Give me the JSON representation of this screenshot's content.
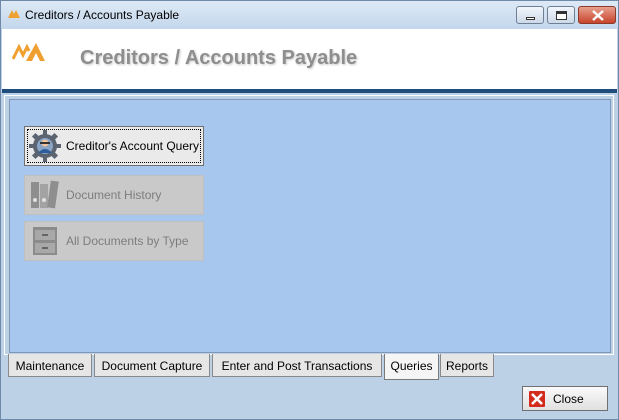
{
  "window": {
    "title": "Creditors / Accounts Payable"
  },
  "header": {
    "title": "Creditors / Accounts Payable"
  },
  "tiles": [
    {
      "label": "Creditor's Account Query",
      "icon": "gear-person-icon",
      "enabled": true
    },
    {
      "label": "Document History",
      "icon": "binders-icon",
      "enabled": false
    },
    {
      "label": "All Documents by Type",
      "icon": "cabinet-drawer-icon",
      "enabled": false
    }
  ],
  "tabs": [
    {
      "label": "Maintenance",
      "selected": false
    },
    {
      "label": "Document Capture",
      "selected": false
    },
    {
      "label": "Enter and Post Transactions",
      "selected": false
    },
    {
      "label": "Queries",
      "selected": true
    },
    {
      "label": "Reports",
      "selected": false
    }
  ],
  "footer": {
    "close_label": "Close"
  },
  "colors": {
    "panel": "#a7c7ee",
    "header_bar": "#1f4e7d",
    "logo": "#f0a030"
  }
}
